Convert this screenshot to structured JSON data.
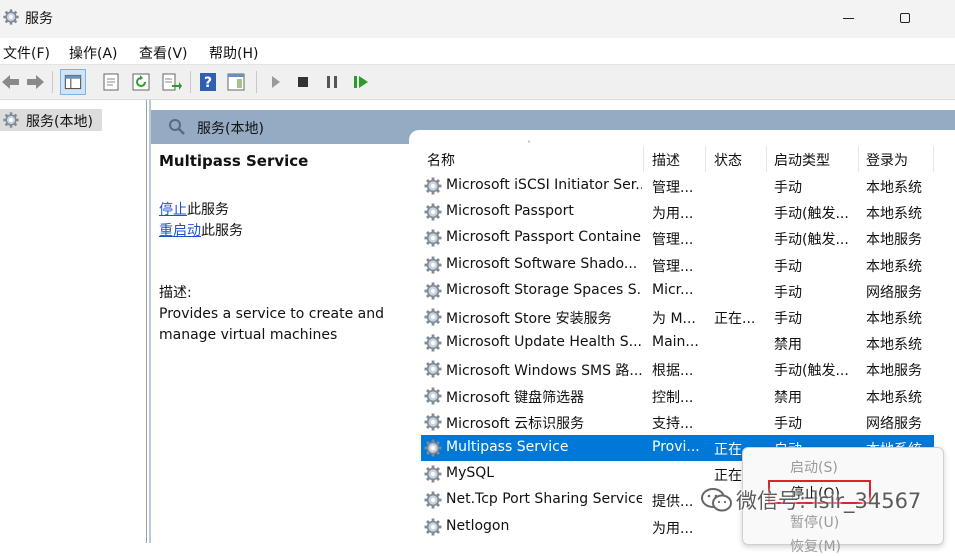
{
  "window": {
    "title": "服务",
    "icon": "gear-icon"
  },
  "menu": {
    "file": "文件(F)",
    "action": "操作(A)",
    "view": "查看(V)",
    "help": "帮助(H)"
  },
  "toolbar": {
    "icons": [
      "back-arrow-icon",
      "forward-arrow-icon",
      "console-tree-icon",
      "properties-icon",
      "refresh-icon",
      "export-list-icon",
      "help-icon",
      "show-hide-pane-icon",
      "play-icon",
      "stop-icon",
      "pause-icon",
      "restart-icon"
    ]
  },
  "tree": {
    "root_label": "服务(本地)"
  },
  "header": {
    "label": "服务(本地)"
  },
  "description": {
    "service_title": "Multipass Service",
    "stop_link": "停止",
    "stop_suffix": "此服务",
    "restart_link": "重启动",
    "restart_suffix": "此服务",
    "desc_label": "描述:",
    "desc_text": "Provides a service to create and manage virtual machines"
  },
  "table": {
    "columns": {
      "name": "名称",
      "desc": "描述",
      "status": "状态",
      "startup": "启动类型",
      "logon": "登录为"
    },
    "sort_indicator": "˄",
    "rows": [
      {
        "name": "Microsoft iSCSI Initiator Ser...",
        "desc": "管理...",
        "status": "",
        "startup": "手动",
        "logon": "本地系统"
      },
      {
        "name": "Microsoft Passport",
        "desc": "为用...",
        "status": "",
        "startup": "手动(触发...",
        "logon": "本地系统"
      },
      {
        "name": "Microsoft Passport Container",
        "desc": "管理...",
        "status": "",
        "startup": "手动(触发...",
        "logon": "本地服务"
      },
      {
        "name": "Microsoft Software Shado...",
        "desc": "管理...",
        "status": "",
        "startup": "手动",
        "logon": "本地系统"
      },
      {
        "name": "Microsoft Storage Spaces S...",
        "desc": "Micr...",
        "status": "",
        "startup": "手动",
        "logon": "网络服务"
      },
      {
        "name": "Microsoft Store 安装服务",
        "desc": "为 M...",
        "status": "正在...",
        "startup": "手动",
        "logon": "本地系统"
      },
      {
        "name": "Microsoft Update Health S...",
        "desc": "Main...",
        "status": "",
        "startup": "禁用",
        "logon": "本地系统"
      },
      {
        "name": "Microsoft Windows SMS 路...",
        "desc": "根据...",
        "status": "",
        "startup": "手动(触发...",
        "logon": "本地服务"
      },
      {
        "name": "Microsoft 键盘筛选器",
        "desc": "控制...",
        "status": "",
        "startup": "禁用",
        "logon": "本地系统"
      },
      {
        "name": "Microsoft 云标识服务",
        "desc": "支持...",
        "status": "",
        "startup": "手动",
        "logon": "网络服务"
      },
      {
        "name": "Multipass Service",
        "desc": "Provi...",
        "status": "正在",
        "startup": "自动",
        "logon": "本地系统"
      },
      {
        "name": "MySQL",
        "desc": "",
        "status": "正在",
        "startup": "",
        "logon": ""
      },
      {
        "name": "Net.Tcp Port Sharing Service",
        "desc": "提供...",
        "status": "",
        "startup": "",
        "logon": ""
      },
      {
        "name": "Netlogon",
        "desc": "为用...",
        "status": "",
        "startup": "",
        "logon": ""
      }
    ]
  },
  "context_menu": {
    "start": "启动(S)",
    "stop": "停止(O)",
    "pause": "暂停(U)",
    "resume": "恢复(M)"
  },
  "watermark": {
    "text": "微信号: lsir_34567"
  },
  "colors": {
    "selection": "#0078d7",
    "header_band": "#94abc3",
    "link": "#1a55c8",
    "highlight_box": "#d9262c"
  }
}
